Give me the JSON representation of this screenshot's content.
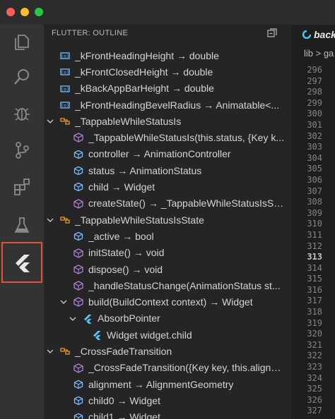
{
  "sidebar": {
    "title": "FLUTTER: OUTLINE",
    "items": [
      {
        "label": "_kFrontHeadingHeight → double",
        "kind": "field",
        "indent": 1,
        "twistie": "none"
      },
      {
        "label": "_kFrontClosedHeight → double",
        "kind": "field",
        "indent": 1,
        "twistie": "none"
      },
      {
        "label": "_kBackAppBarHeight → double",
        "kind": "field",
        "indent": 1,
        "twistie": "none"
      },
      {
        "label": "_kFrontHeadingBevelRadius → Animatable<...",
        "kind": "field",
        "indent": 1,
        "twistie": "none"
      },
      {
        "label": "_TappableWhileStatusIs",
        "kind": "class",
        "indent": 1,
        "twistie": "open"
      },
      {
        "label": "_TappableWhileStatusIs(this.status, {Key k...",
        "kind": "method",
        "indent": 2,
        "twistie": "none"
      },
      {
        "label": "controller → AnimationController",
        "kind": "property",
        "indent": 2,
        "twistie": "none"
      },
      {
        "label": "status → AnimationStatus",
        "kind": "property",
        "indent": 2,
        "twistie": "none"
      },
      {
        "label": "child → Widget",
        "kind": "property",
        "indent": 2,
        "twistie": "none"
      },
      {
        "label": "createState() → _TappableWhileStatusIsState",
        "kind": "method",
        "indent": 2,
        "twistie": "none"
      },
      {
        "label": "_TappableWhileStatusIsState",
        "kind": "class",
        "indent": 1,
        "twistie": "open"
      },
      {
        "label": "_active → bool",
        "kind": "property",
        "indent": 2,
        "twistie": "none"
      },
      {
        "label": "initState() → void",
        "kind": "method",
        "indent": 2,
        "twistie": "none"
      },
      {
        "label": "dispose() → void",
        "kind": "method",
        "indent": 2,
        "twistie": "none"
      },
      {
        "label": "_handleStatusChange(AnimationStatus st...",
        "kind": "method",
        "indent": 2,
        "twistie": "none"
      },
      {
        "label": "build(BuildContext context) → Widget",
        "kind": "method",
        "indent": 2,
        "twistie": "open"
      },
      {
        "label": "AbsorbPointer",
        "kind": "flutter",
        "indent": 3,
        "twistie": "open"
      },
      {
        "label": "Widget widget.child",
        "kind": "flutter",
        "indent": 4,
        "twistie": "none"
      },
      {
        "label": "_CrossFadeTransition",
        "kind": "class",
        "indent": 1,
        "twistie": "open"
      },
      {
        "label": "_CrossFadeTransition({Key key, this.alignm...",
        "kind": "method",
        "indent": 2,
        "twistie": "none"
      },
      {
        "label": "alignment → AlignmentGeometry",
        "kind": "property",
        "indent": 2,
        "twistie": "none"
      },
      {
        "label": "child0 → Widget",
        "kind": "property",
        "indent": 2,
        "twistie": "none"
      },
      {
        "label": "child1 → Widget",
        "kind": "property",
        "indent": 2,
        "twistie": "none"
      }
    ]
  },
  "editor": {
    "tab_label": "back",
    "breadcrumb": "lib > ga",
    "current_line": 313,
    "line_numbers": [
      296,
      297,
      298,
      299,
      300,
      301,
      302,
      303,
      304,
      305,
      306,
      307,
      308,
      309,
      310,
      311,
      312,
      313,
      314,
      315,
      316,
      317,
      318,
      319,
      320,
      321,
      322,
      323,
      324,
      325,
      326,
      327
    ]
  },
  "colors": {
    "field_icon": "#75beff",
    "class_icon": "#ee9d28",
    "method_icon": "#b180d7",
    "property_icon": "#75beff",
    "flutter_icon": "#54c5f8",
    "active_highlight": "#e0533a"
  },
  "activity_bar": {
    "icons": [
      "files-icon",
      "search-icon",
      "debug-icon",
      "source-control-icon",
      "extensions-icon",
      "test-flask-icon",
      "flutter-outline-icon"
    ]
  }
}
